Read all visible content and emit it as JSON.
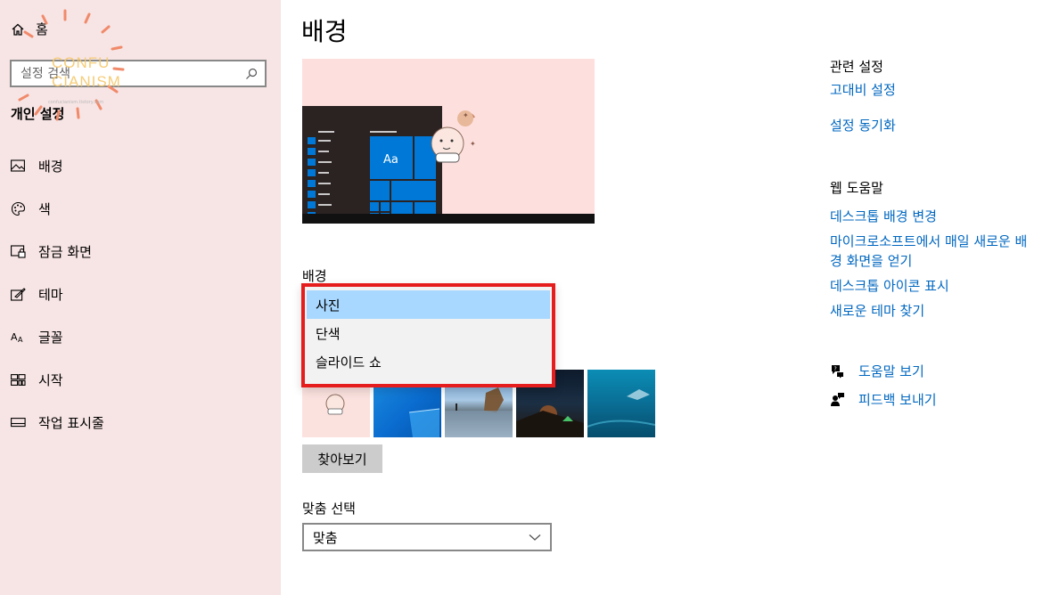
{
  "sidebar": {
    "home_label": "홈",
    "search_placeholder": "설정 검색",
    "section_title": "개인 설정",
    "items": [
      {
        "label": "배경",
        "icon": "picture-icon"
      },
      {
        "label": "색",
        "icon": "palette-icon"
      },
      {
        "label": "잠금 화면",
        "icon": "lock-screen-icon"
      },
      {
        "label": "테마",
        "icon": "theme-icon"
      },
      {
        "label": "글꼴",
        "icon": "font-icon"
      },
      {
        "label": "시작",
        "icon": "start-icon"
      },
      {
        "label": "작업 표시줄",
        "icon": "taskbar-icon"
      }
    ]
  },
  "watermark": {
    "text_line1": "CONFU",
    "text_line2": "CIANISM",
    "sub": "confucianism.tistory.com"
  },
  "main": {
    "title": "배경",
    "preview_tile_label": "Aa",
    "background_label": "배경",
    "background_options": [
      "사진",
      "단색",
      "슬라이드 쇼"
    ],
    "background_selected": "사진",
    "browse_label": "찾아보기",
    "fit_label": "맞춤 선택",
    "fit_value": "맞춤"
  },
  "right": {
    "related_title": "관련 설정",
    "related_links": [
      "고대비 설정",
      "설정 동기화"
    ],
    "web_help_title": "웹 도움말",
    "web_help_links": [
      "데스크톱 배경 변경",
      "마이크로소프트에서 매일 새로운 배경 화면을 얻기",
      "데스크톱 아이콘 표시",
      "새로운 테마 찾기"
    ],
    "help_label": "도움말 보기",
    "feedback_label": "피드백 보내기"
  },
  "colors": {
    "accent": "#0067c0",
    "sidebar_bg": "#f7e4e4",
    "highlight_border": "#e61d1d",
    "selected_option": "#a8d8ff",
    "preview_bg": "#fde0de"
  }
}
